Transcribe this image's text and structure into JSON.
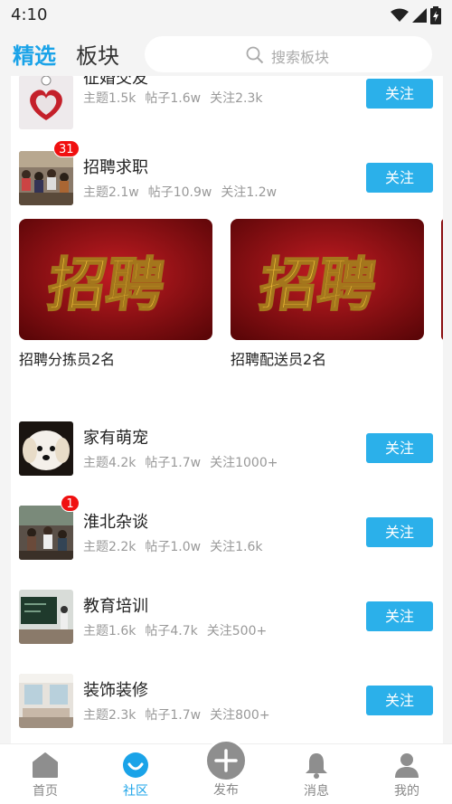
{
  "status_bar": {
    "time": "4:10"
  },
  "header": {
    "tabs": [
      {
        "label": "精选",
        "active": true
      },
      {
        "label": "板块",
        "active": false
      }
    ],
    "search": {
      "placeholder": "搜索板块",
      "icon": "search-icon"
    }
  },
  "boards_top": [
    {
      "name": "征婚交友",
      "topics": "主题1.5k",
      "posts": "帖子1.6w",
      "followers": "关注2.3k",
      "follow_label": "关注",
      "thumb": "heart-gift"
    },
    {
      "name": "招聘求职",
      "topics": "主题2.1w",
      "posts": "帖子10.9w",
      "followers": "关注1.2w",
      "follow_label": "关注",
      "badge": "31",
      "thumb": "job-fair-crowd"
    }
  ],
  "banners": [
    {
      "caption": "招聘分拣员2名",
      "image_text": "招聘"
    },
    {
      "caption": "招聘配送员2名",
      "image_text": "招聘"
    }
  ],
  "boards_bottom": [
    {
      "name": "家有萌宠",
      "topics": "主题4.2k",
      "posts": "帖子1.7w",
      "followers": "关注1000+",
      "follow_label": "关注",
      "thumb": "puppy"
    },
    {
      "name": "淮北杂谈",
      "topics": "主题2.2k",
      "posts": "帖子1.0w",
      "followers": "关注1.6k",
      "follow_label": "关注",
      "badge": "1",
      "thumb": "street-scene"
    },
    {
      "name": "教育培训",
      "topics": "主题1.6k",
      "posts": "帖子4.7k",
      "followers": "关注500+",
      "follow_label": "关注",
      "thumb": "classroom"
    },
    {
      "name": "装饰装修",
      "topics": "主题2.3k",
      "posts": "帖子1.7w",
      "followers": "关注800+",
      "follow_label": "关注",
      "thumb": "living-room"
    }
  ],
  "bottom_nav": [
    {
      "label": "首页",
      "icon": "home-icon",
      "active": false
    },
    {
      "label": "社区",
      "icon": "community-icon",
      "active": true
    },
    {
      "label": "发布",
      "icon": "plus-icon",
      "active": false
    },
    {
      "label": "消息",
      "icon": "bell-icon",
      "active": false
    },
    {
      "label": "我的",
      "icon": "user-icon",
      "active": false
    }
  ],
  "colors": {
    "accent": "#1aa3e8",
    "follow_button": "#2bb0ea",
    "badge": "#f01010",
    "banner_red": "#a3151a",
    "banner_gold": "#f5c43a"
  }
}
